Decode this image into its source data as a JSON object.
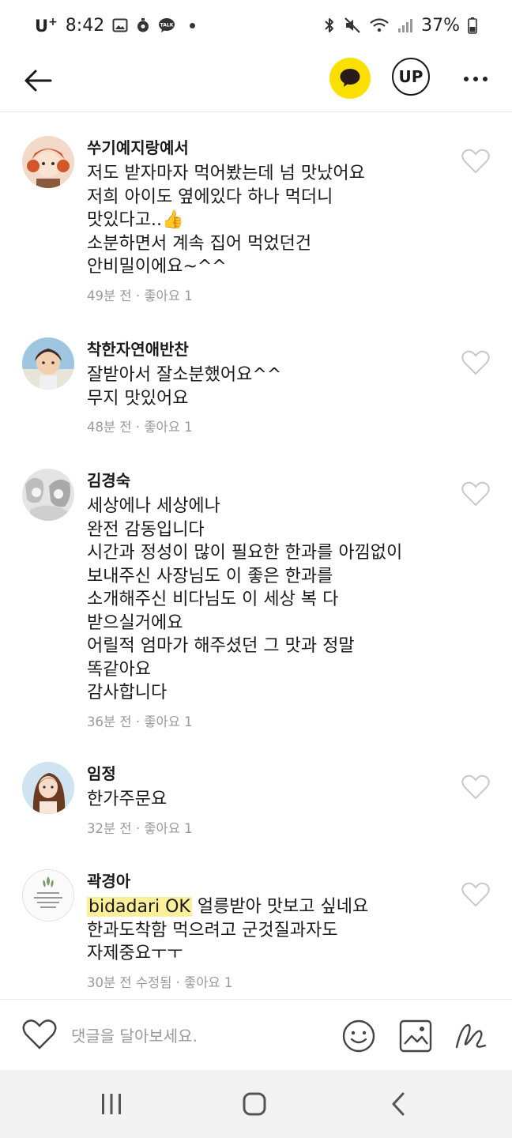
{
  "status_bar": {
    "carrier": "U",
    "carrier_plus": "+",
    "time": "8:42",
    "battery": "37%"
  },
  "app_bar": {
    "up_label": "UP"
  },
  "comments": [
    {
      "author": "쑤기예지랑예서",
      "text": "저도 받자마자 먹어봤는데 넘 맛났어요\n저희 아이도 옆에있다 하나 먹더니\n맛있다고..👍\n소분하면서 계속 집어 먹었던건\n안비밀이에요~^^",
      "time": "49분 전",
      "likes": "좋아요 1"
    },
    {
      "author": "착한자연애반찬",
      "text": "잘받아서   잘소분했어요^^\n무지 맛있어요",
      "time": "48분 전",
      "likes": "좋아요 1"
    },
    {
      "author": "김경숙",
      "text": "세상에나 세상에나\n완전 감동입니다\n시간과 정성이 많이 필요한 한과를 아낌없이\n보내주신 사장님도 이 좋은 한과를\n소개해주신 비다님도 이 세상 복 다\n받으실거에요\n어릴적 엄마가 해주셨던 그 맛과 정말\n똑같아요\n감사합니다",
      "time": "36분 전",
      "likes": "좋아요 1"
    },
    {
      "author": "임정",
      "text": "한가주문요",
      "time": "32분 전",
      "likes": "좋아요 1"
    },
    {
      "author": "곽경아",
      "mention": "bidadari OK",
      "text": " 얼릉받아 맛보고 싶네요\n한과도착함 먹으려고 군것질과자도\n자제중요ㅜㅜ",
      "time": "30분 전 수정됨",
      "likes": "좋아요 1"
    }
  ],
  "meta_separator": " · ",
  "input_bar": {
    "placeholder": "댓글을 달아보세요."
  },
  "colors": {
    "kakao_yellow": "#f9e000",
    "mention_highlight": "#fbef9a",
    "meta_gray": "#9a9a9a"
  }
}
